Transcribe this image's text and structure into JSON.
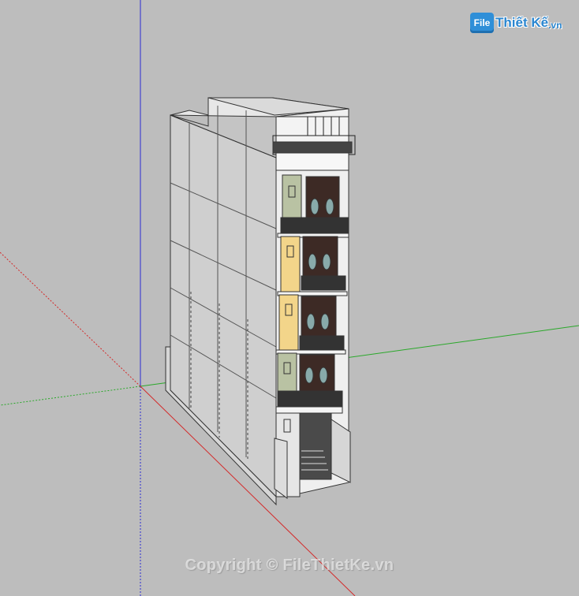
{
  "logo": {
    "badge": "File",
    "text": "Thiết Kế",
    "suffix": ".vn"
  },
  "watermark": "Copyright © FileThietKe.vn",
  "colors": {
    "background": "#bdbdbd",
    "axis_red": "#d42a2a",
    "axis_green": "#2aa82a",
    "axis_blue": "#2a2ad4",
    "wall_side": "#c9c9c9",
    "wall_front": "#ececec",
    "panel_green": "#b9c2a3",
    "panel_yellow": "#f3d58a",
    "door_dark": "#3d2a25"
  }
}
